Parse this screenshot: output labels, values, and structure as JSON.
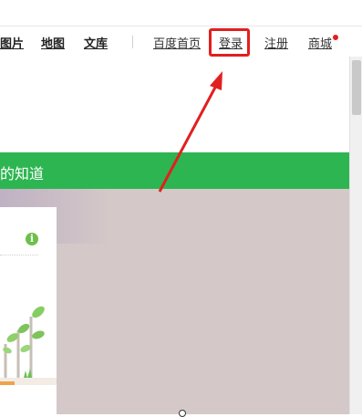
{
  "nav": {
    "links": [
      {
        "label": "图片"
      },
      {
        "label": "地图"
      },
      {
        "label": "文库"
      },
      {
        "label": "百度首页"
      },
      {
        "label": "登录"
      },
      {
        "label": "注册"
      },
      {
        "label": "商城"
      }
    ]
  },
  "banner": {
    "title": "的知道"
  },
  "card": {
    "info_glyph": "i"
  },
  "colors": {
    "accent_green": "#2db551",
    "highlight_red": "#e21f1f",
    "hero_bg": "#d4c8c8"
  }
}
